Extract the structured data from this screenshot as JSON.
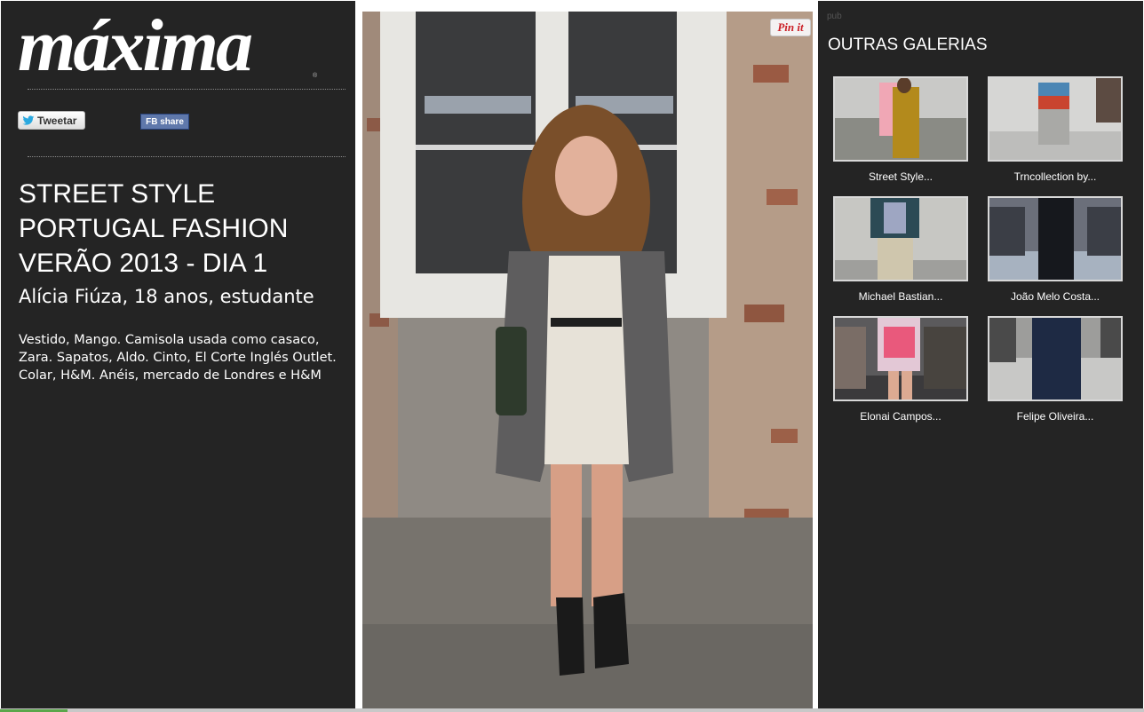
{
  "brand": {
    "logo_text": "máxima",
    "logo_mark": "®"
  },
  "share": {
    "tweet_label": "Tweetar",
    "fb_label": "FB share",
    "pin_label": "Pin it"
  },
  "article": {
    "title": "STREET STYLE PORTUGAL FASHION VERÃO 2013 - DIA 1",
    "subtitle": "Alícia Fiúza, 18 anos, estudante",
    "description": "Vestido, Mango. Camisola usada como casaco, Zara. Sapatos, Aldo. Cinto, El Corte Inglés Outlet. Colar, H&M. Anéis, mercado de Londres e H&M"
  },
  "sidebar": {
    "pub_label": "pub",
    "heading": "OUTRAS GALERIAS",
    "galleries": [
      {
        "label": "Street Style..."
      },
      {
        "label": "Trncollection by..."
      },
      {
        "label": "Michael Bastian..."
      },
      {
        "label": "João Melo Costa..."
      },
      {
        "label": "Elonai Campos..."
      },
      {
        "label": "Felipe Oliveira..."
      }
    ]
  },
  "colors": {
    "panel_bg": "#242424",
    "text": "#ffffff",
    "pinterest_red": "#cb2027",
    "facebook_blue": "#5f78ab"
  }
}
